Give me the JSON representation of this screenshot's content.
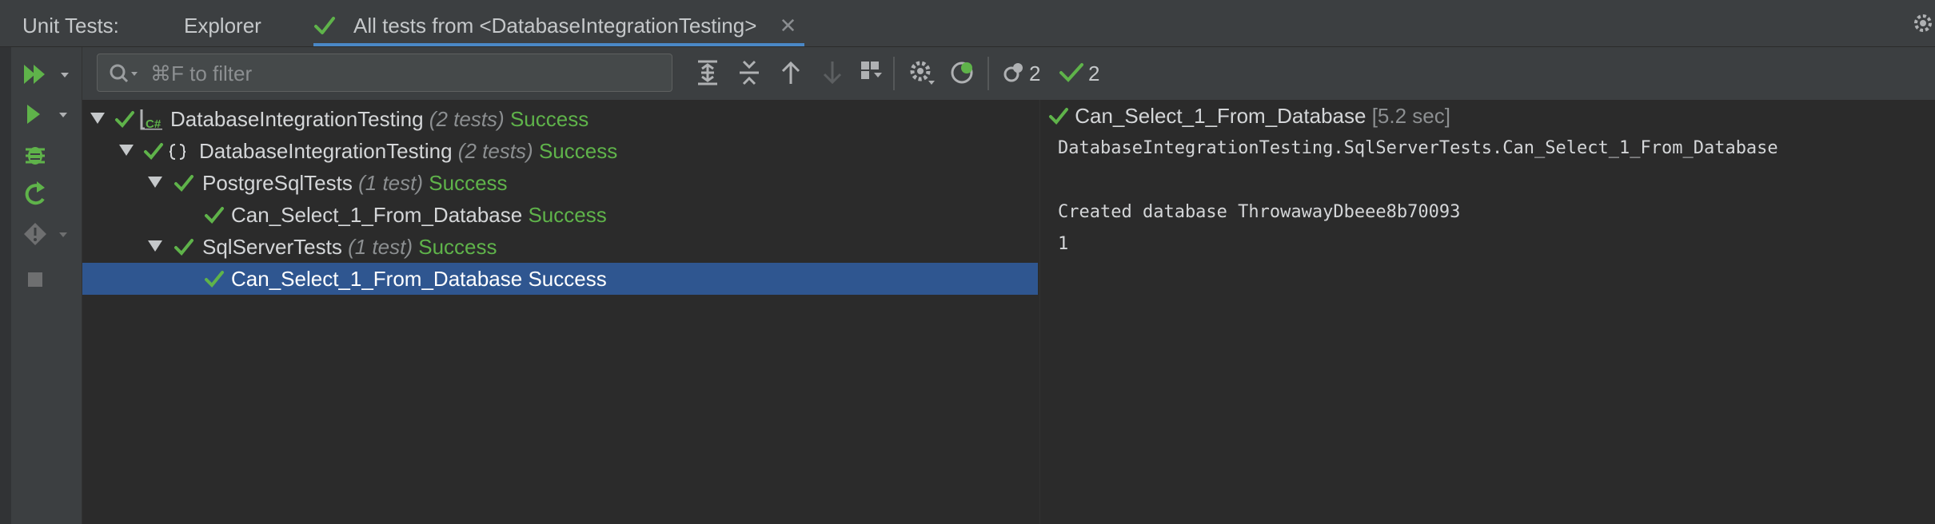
{
  "header": {
    "title": "Unit Tests:",
    "tabs": [
      {
        "label": "Explorer"
      },
      {
        "label": "All tests from <DatabaseIntegrationTesting>"
      }
    ],
    "close_glyph": "✕"
  },
  "toolbar": {
    "search_placeholder": "⌘F to filter",
    "pending_count": "2",
    "passed_count": "2"
  },
  "tree": [
    {
      "label": "DatabaseIntegrationTesting",
      "meta": "(2 tests)",
      "status": "Success",
      "icon": "csharp-project-icon"
    },
    {
      "label": "DatabaseIntegrationTesting",
      "meta": "(2 tests)",
      "status": "Success",
      "icon": "namespace-icon"
    },
    {
      "label": "PostgreSqlTests",
      "meta": "(1 test)",
      "status": "Success"
    },
    {
      "label": "Can_Select_1_From_Database",
      "meta": "",
      "status": "Success"
    },
    {
      "label": "SqlServerTests",
      "meta": "(1 test)",
      "status": "Success"
    },
    {
      "label": "Can_Select_1_From_Database",
      "meta": "",
      "status": "Success",
      "selected": true
    }
  ],
  "output": {
    "test_name": "Can_Select_1_From_Database",
    "duration": "[5.2 sec]",
    "lines": [
      "DatabaseIntegrationTesting.SqlServerTests.Can_Select_1_From_Database",
      "",
      "Created database ThrowawayDbeee8b70093",
      "1"
    ]
  },
  "colors": {
    "success": "#5fb34a",
    "selection": "#2f5690",
    "accent": "#4a88c7"
  }
}
